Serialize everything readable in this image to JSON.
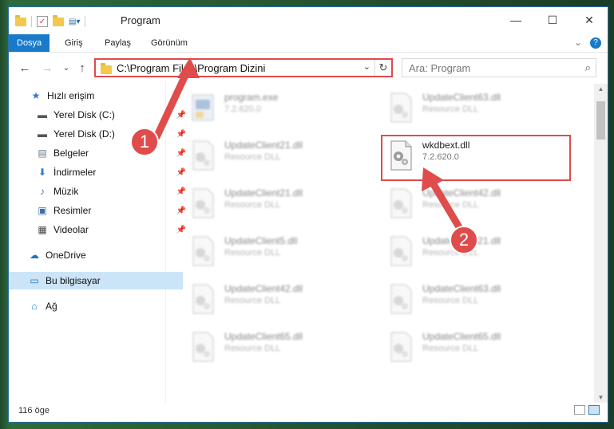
{
  "window": {
    "title": "Program",
    "controls": {
      "minimize": "—",
      "maximize": "☐",
      "close": "✕"
    }
  },
  "ribbon": {
    "tabs": [
      {
        "label": "Dosya",
        "active": true
      },
      {
        "label": "Giriş"
      },
      {
        "label": "Paylaş"
      },
      {
        "label": "Görünüm"
      }
    ],
    "collapse": "⌄",
    "help": "?"
  },
  "nav": {
    "back": "←",
    "forward": "→",
    "recent": "⌄",
    "up": "↑"
  },
  "address": {
    "path": "C:\\Program Files\\Program Dizini",
    "dropdown": "⌄",
    "refresh": "↻"
  },
  "search": {
    "placeholder": "Ara: Program",
    "icon": "⌕"
  },
  "sidebar": {
    "items": [
      {
        "label": "Hızlı erişim",
        "icon": "★",
        "pinned": false
      },
      {
        "label": "Yerel Disk (C:)",
        "icon": "▬",
        "pinned": true
      },
      {
        "label": "Yerel Disk (D:)",
        "icon": "▬",
        "pinned": true
      },
      {
        "label": "Belgeler",
        "icon": "▤",
        "pinned": true
      },
      {
        "label": "İndirmeler",
        "icon": "⬇",
        "pinned": true
      },
      {
        "label": "Müzik",
        "icon": "♪",
        "pinned": true
      },
      {
        "label": "Resimler",
        "icon": "▣",
        "pinned": true
      },
      {
        "label": "Videolar",
        "icon": "▦",
        "pinned": true
      },
      {
        "label": "OneDrive",
        "icon": "☁",
        "pinned": false
      },
      {
        "label": "Bu bilgisayar",
        "icon": "▭",
        "pinned": false,
        "selected": true
      },
      {
        "label": "Ağ",
        "icon": "⌂",
        "pinned": false
      }
    ],
    "pin_glyph": "📌"
  },
  "files": [
    {
      "name": "program.exe",
      "sub": "7.2.620.0",
      "type": "exe"
    },
    {
      "name": "UpdateClient63.dll",
      "sub": "Resource DLL",
      "type": "dll"
    },
    {
      "name": "UpdateClient21.dll",
      "sub": "Resource DLL",
      "type": "dll"
    },
    {
      "name": "wkdbext.dll",
      "sub": "7.2.620.0",
      "type": "dll",
      "highlight": true
    },
    {
      "name": "UpdateClient21.dll",
      "sub": "Resource DLL",
      "type": "dll"
    },
    {
      "name": "UpdateClient42.dll",
      "sub": "Resource DLL",
      "type": "dll"
    },
    {
      "name": "UpdateClient5.dll",
      "sub": "Resource DLL",
      "type": "dll"
    },
    {
      "name": "UpdateClient21.dll",
      "sub": "Resource DLL",
      "type": "dll"
    },
    {
      "name": "UpdateClient42.dll",
      "sub": "Resource DLL",
      "type": "dll"
    },
    {
      "name": "UpdateClient63.dll",
      "sub": "Resource DLL",
      "type": "dll"
    },
    {
      "name": "UpdateClient65.dll",
      "sub": "Resource DLL",
      "type": "dll"
    },
    {
      "name": "UpdateClient65.dll",
      "sub": "Resource DLL",
      "type": "dll"
    }
  ],
  "status": {
    "count": "116 öge"
  },
  "annotations": {
    "badge1": "1",
    "badge2": "2",
    "color": "#e04b4b"
  }
}
